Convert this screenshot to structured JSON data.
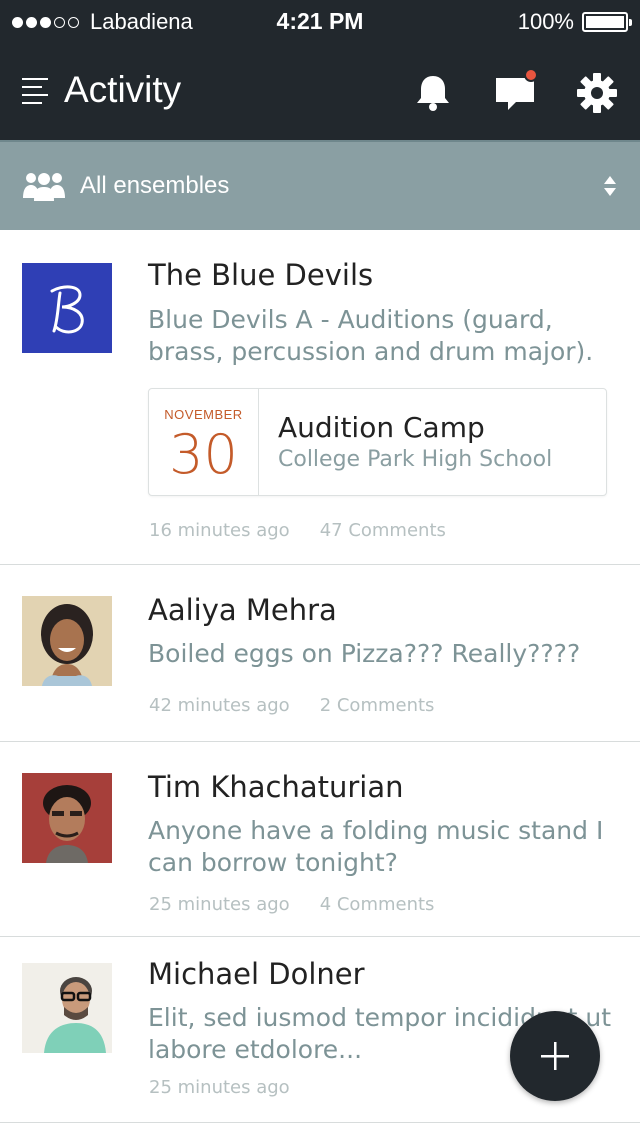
{
  "status_bar": {
    "carrier": "Labadiena",
    "time": "4:21 PM",
    "battery": "100%",
    "signal_bars": 3,
    "signal_total": 5
  },
  "header": {
    "title": "Activity",
    "icons": [
      "menu-icon",
      "bell-icon",
      "chat-icon",
      "gear-icon"
    ]
  },
  "filter": {
    "label": "All ensembles",
    "icon": "group-icon"
  },
  "posts": [
    {
      "name": "The Blue Devils",
      "text": "Blue Devils A - Auditions (guard, brass, percussion and drum major).",
      "event": {
        "month": "NOVEMBER",
        "day": "30",
        "title": "Audition Camp",
        "location": "College Park High School"
      },
      "time": "16 minutes ago",
      "comments": "47 Comments"
    },
    {
      "name": "Aaliya Mehra",
      "text": "Boiled eggs on Pizza??? Really????",
      "time": "42 minutes ago",
      "comments": "2 Comments"
    },
    {
      "name": "Tim Khachaturian",
      "text": "Anyone have a folding music stand I can borrow tonight?",
      "time": "25 minutes ago",
      "comments": "4 Comments"
    },
    {
      "name": "Michael Dolner",
      "text": "Elit, sed iusmod tempor incididunt ut labore etdolore...",
      "time": "25 minutes ago"
    }
  ],
  "colors": {
    "header_bg": "#22282d",
    "filter_bg": "#8a9fa3",
    "event_accent": "#c45b2a",
    "brand_logo_bg": "#2f3fb5",
    "notification_dot": "#e8553f"
  }
}
